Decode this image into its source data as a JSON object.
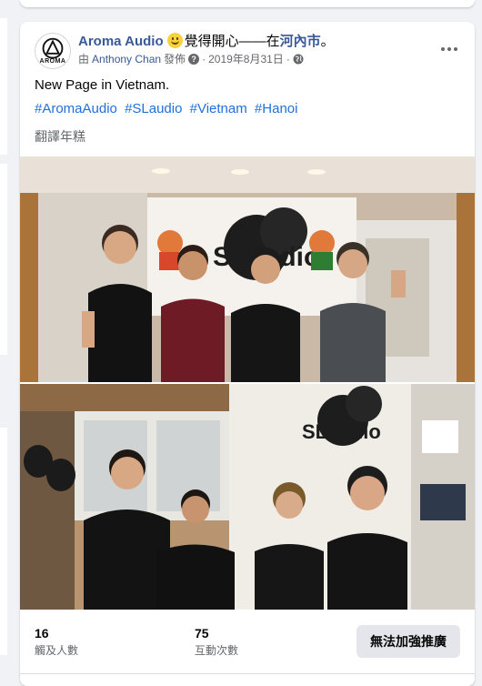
{
  "post": {
    "page_name": "Aroma Audio",
    "feeling": "覺得開心——在",
    "location": "河內市",
    "location_suffix": "。",
    "meta_prefix": "由",
    "author": "Anthony Chan",
    "meta_posted": "發佈",
    "date": "2019年8月31日",
    "meta_sep": "·",
    "text": "New Page in Vietnam.",
    "hashtags": [
      "#AromaAudio",
      "#SLaudio",
      "#Vietnam",
      "#Hanoi"
    ],
    "translate_label": "翻譯年糕",
    "avatar_text": "AROMA",
    "photo_sign_text": "SLaudio"
  },
  "stats": {
    "reach_value": "16",
    "reach_label": "觸及人數",
    "engagement_value": "75",
    "engagement_label": "互動次數"
  },
  "boost": {
    "label": "無法加強推廣"
  },
  "icons": {
    "feeling": "smiling-face-icon",
    "privacy": "globe-icon",
    "info": "question-mark-icon",
    "more": "more-horizontal-icon"
  }
}
